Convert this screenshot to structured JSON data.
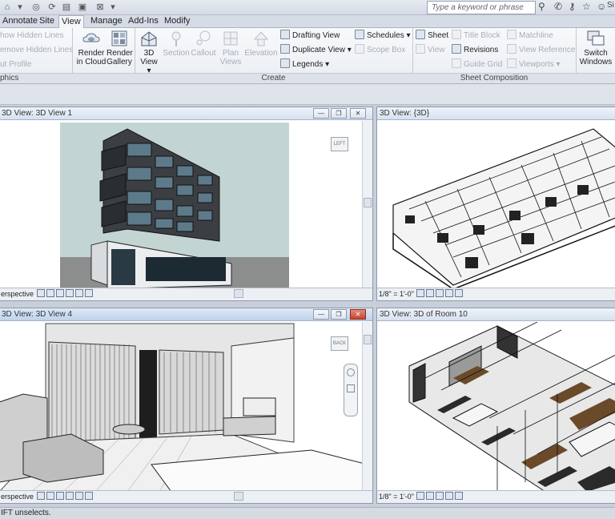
{
  "qat": {
    "search_placeholder": "Type a keyword or phrase",
    "user_initial": "Si"
  },
  "tabs": [
    "Annotate",
    "Site",
    "View",
    "Manage",
    "Add-Ins",
    "Modify"
  ],
  "active_tab": "View",
  "ribbon": {
    "graphics": {
      "show_hidden_lines": "how  Hidden Lines",
      "remove_hidden_lines": "emove  Hidden Lines",
      "cut_profile": "ut  Profile",
      "panel_label": "phics"
    },
    "render_cloud": {
      "line1": "Render",
      "line2": "in Cloud"
    },
    "render_gallery": {
      "line1": "Render",
      "line2": "Gallery"
    },
    "create": {
      "view_3d": {
        "line1": "3D",
        "line2": "View"
      },
      "section": "Section",
      "callout": "Callout",
      "plan_views": {
        "line1": "Plan",
        "line2": "Views"
      },
      "elevation": "Elevation",
      "drafting_view": "Drafting  View",
      "duplicate_view": "Duplicate  View",
      "legends": "Legends",
      "schedules": "Schedules",
      "scope_box": "Scope  Box",
      "panel_label": "Create"
    },
    "sheet_composition": {
      "sheet": "Sheet",
      "title_block": "Title  Block",
      "matchline": "Matchline",
      "view": "View",
      "revisions": "Revisions",
      "view_reference": "View  Reference",
      "guide_grid": "Guide  Grid",
      "viewports": "Viewports",
      "panel_label": "Sheet Composition"
    },
    "windows": {
      "switch_windows": {
        "line1": "Switch",
        "line2": "Windows"
      }
    }
  },
  "views": {
    "v1": {
      "title": "3D View: 3D View 1",
      "status": "erspective",
      "cube_label": "LEFT"
    },
    "v2": {
      "title": "3D View: {3D}",
      "status": "1/8\" = 1'-0\""
    },
    "v3": {
      "title": "3D View: 3D View 4",
      "status": "erspective",
      "cube_label": "BACK"
    },
    "v4": {
      "title": "3D View: 3D of Room 10",
      "status": "1/8\" = 1'-0\""
    }
  },
  "statusbar": {
    "text": "IFT unselects."
  },
  "colors": {
    "ribbon_bg": "#f8f9fb",
    "title_bar": "#d6e1ef",
    "close_red": "#c9452e",
    "sky": "#c3d5d3"
  }
}
